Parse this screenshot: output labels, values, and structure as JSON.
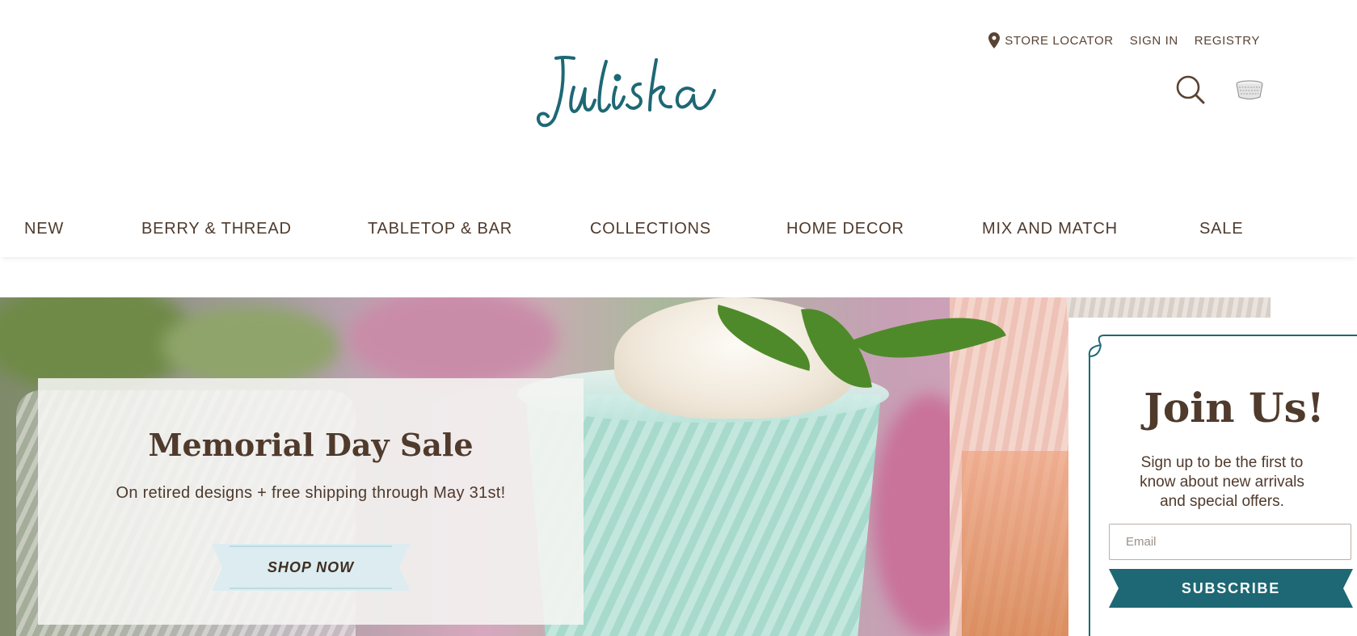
{
  "colors": {
    "brand_teal": "#1d6874",
    "text_brown": "#4f3a2c",
    "shop_now_bg": "#dcecf0"
  },
  "header": {
    "logo_text": "Juliska",
    "utility_links": [
      {
        "label": "STORE LOCATOR",
        "icon": "map-pin-icon"
      },
      {
        "label": "SIGN IN"
      },
      {
        "label": "REGISTRY"
      }
    ],
    "icons": [
      "search-icon",
      "cart-basket-icon"
    ]
  },
  "nav": {
    "items": [
      {
        "label": "NEW"
      },
      {
        "label": "BERRY & THREAD"
      },
      {
        "label": "TABLETOP & BAR"
      },
      {
        "label": "COLLECTIONS"
      },
      {
        "label": "HOME DECOR"
      },
      {
        "label": "MIX AND MATCH"
      },
      {
        "label": "SALE"
      }
    ]
  },
  "hero": {
    "title": "Memorial Day Sale",
    "subtitle": "On retired designs + free shipping through May 31st!",
    "cta_label": "SHOP NOW"
  },
  "popup": {
    "title": "Join Us!",
    "subtitle": "Sign up to be the first to know about new arrivals and special offers.",
    "email_placeholder": "Email",
    "email_value": "",
    "subscribe_label": "SUBSCRIBE"
  }
}
